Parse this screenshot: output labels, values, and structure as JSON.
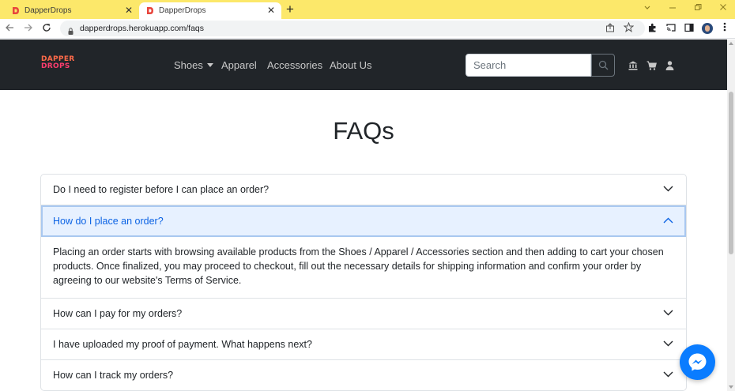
{
  "browser": {
    "tabs": [
      {
        "title": "DapperDrops",
        "active": false
      },
      {
        "title": "DapperDrops",
        "active": true
      }
    ],
    "new_tab_symbol": "+",
    "close_symbol": "✕",
    "url": "dapperdrops.herokuapp.com/faqs",
    "colors": {
      "tabbar": "#fce86a",
      "favicon": "#e8453c"
    }
  },
  "site": {
    "logo_line1": "DAPPER",
    "logo_line2": "DROPS",
    "nav": {
      "items": [
        {
          "label": "Shoes",
          "dropdown": true
        },
        {
          "label": "Apparel",
          "dropdown": false
        },
        {
          "label": "Accessories",
          "dropdown": false
        },
        {
          "label": "About Us",
          "dropdown": false
        }
      ],
      "search_placeholder": "Search",
      "icons": [
        "search-icon",
        "bank-icon",
        "cart-icon",
        "user-icon"
      ]
    },
    "colors": {
      "navbar": "#212529",
      "accent_active": "#0c63e4",
      "active_bg": "#e7f1ff"
    }
  },
  "page": {
    "title": "FAQs",
    "faqs": [
      {
        "question": "Do I need to register before I can place an order?",
        "open": false
      },
      {
        "question": "How do I place an order?",
        "open": true,
        "answer": "Placing an order starts with browsing available products from the Shoes / Apparel / Accessories section and then adding to cart your chosen products. Once finalized, you may proceed to checkout, fill out the necessary details for shipping information and confirm your order by agreeing to our website's Terms of Service."
      },
      {
        "question": "How can I pay for my orders?",
        "open": false
      },
      {
        "question": "I have uploaded my proof of payment. What happens next?",
        "open": false
      },
      {
        "question": "How can I track my orders?",
        "open": false
      }
    ]
  },
  "widgets": {
    "chat": "messenger-icon"
  }
}
